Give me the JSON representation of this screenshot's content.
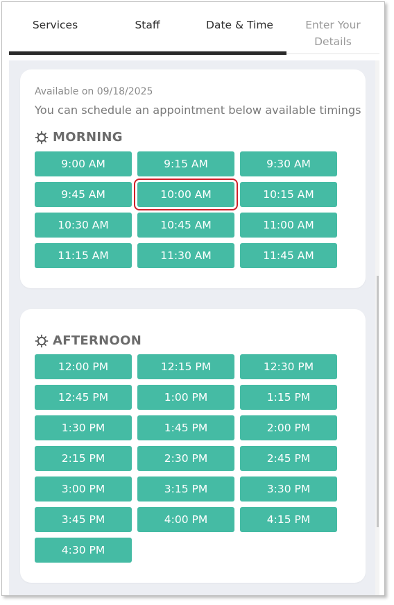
{
  "tabs": [
    {
      "label": "Services",
      "state": "done"
    },
    {
      "label": "Staff",
      "state": "done"
    },
    {
      "label": "Date & Time",
      "state": "active"
    },
    {
      "label": "Enter Your Details",
      "state": "upcoming"
    }
  ],
  "availability": {
    "date_text": "Available on 09/18/2025",
    "message": "You can schedule an appointment below available timings"
  },
  "morning": {
    "title": "MORNING",
    "icon": "sun-icon",
    "slots": [
      "9:00 AM",
      "9:15 AM",
      "9:30 AM",
      "9:45 AM",
      "10:00 AM",
      "10:15 AM",
      "10:30 AM",
      "10:45 AM",
      "11:00 AM",
      "11:15 AM",
      "11:30 AM",
      "11:45 AM"
    ],
    "highlighted": "10:00 AM"
  },
  "afternoon": {
    "title": "AFTERNOON",
    "icon": "sun-icon",
    "slots": [
      "12:00 PM",
      "12:15 PM",
      "12:30 PM",
      "12:45 PM",
      "1:00 PM",
      "1:15 PM",
      "1:30 PM",
      "1:45 PM",
      "2:00 PM",
      "2:15 PM",
      "2:30 PM",
      "2:45 PM",
      "3:00 PM",
      "3:15 PM",
      "3:30 PM",
      "3:45 PM",
      "4:00 PM",
      "4:15 PM",
      "4:30 PM"
    ]
  },
  "colors": {
    "slot_bg": "#45bba4",
    "slot_text": "#ffffff",
    "highlight": "#d0202a",
    "active_tab_bar": "#2b2b2b",
    "background": "#eceef3"
  }
}
